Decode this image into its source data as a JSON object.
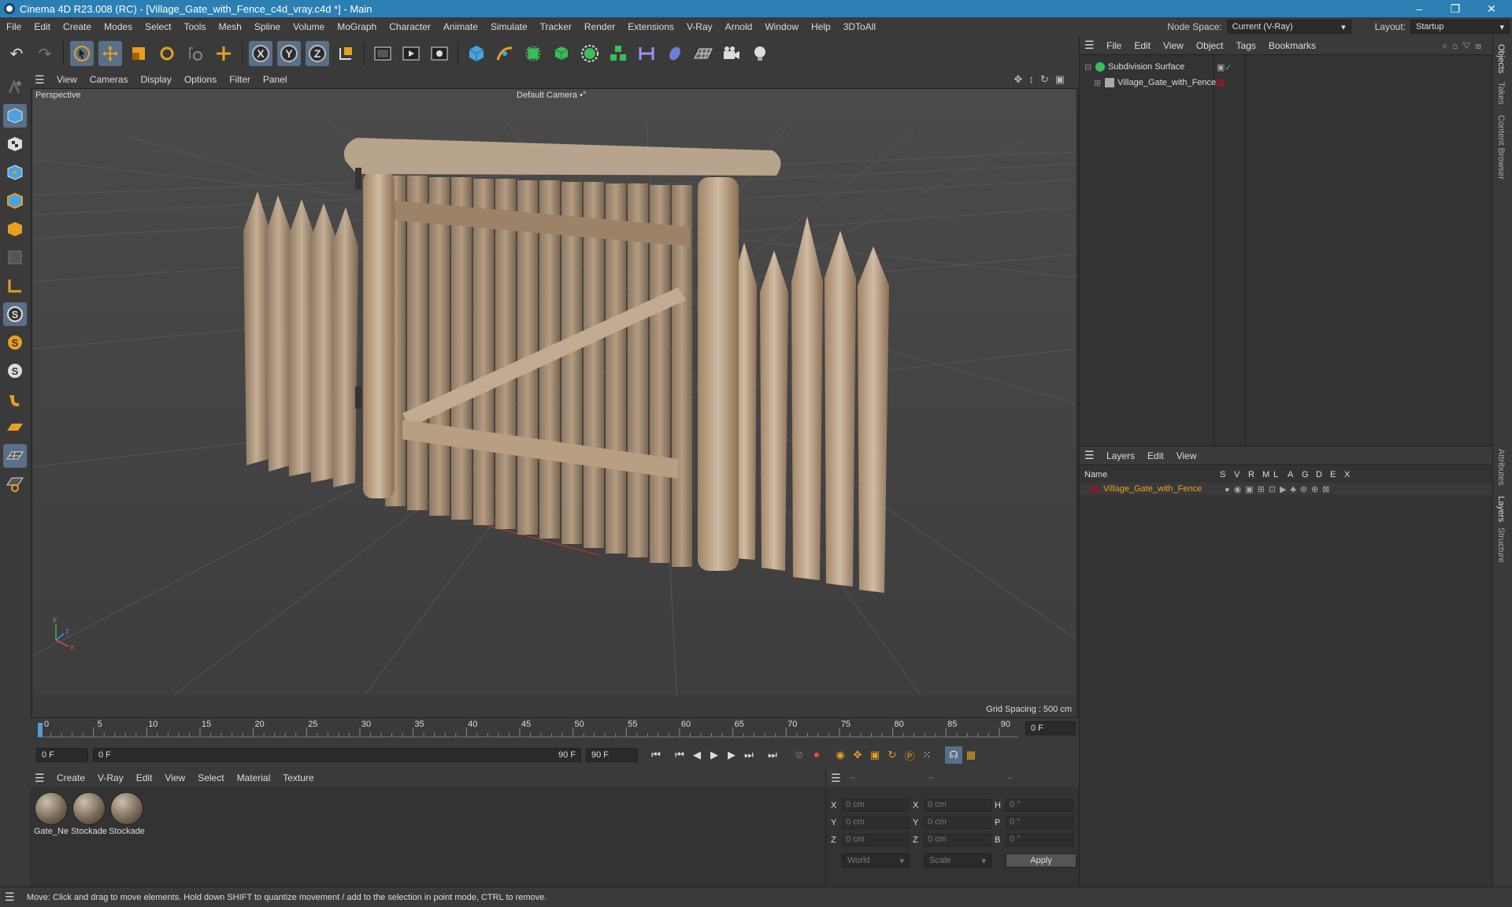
{
  "window": {
    "title": "Cinema 4D R23.008 (RC) - [Village_Gate_with_Fence_c4d_vray.c4d *] - Main",
    "minimize": "–",
    "restore": "❐",
    "close": "✕"
  },
  "menubar": {
    "items": [
      "File",
      "Edit",
      "Create",
      "Modes",
      "Select",
      "Tools",
      "Mesh",
      "Spline",
      "Volume",
      "MoGraph",
      "Character",
      "Animate",
      "Simulate",
      "Tracker",
      "Render",
      "Extensions",
      "V-Ray",
      "Arnold",
      "Window",
      "Help",
      "3DToAll"
    ],
    "node_space_label": "Node Space:",
    "node_space_value": "Current (V-Ray)",
    "layout_label": "Layout:",
    "layout_value": "Startup"
  },
  "toolbar": {
    "icons": [
      "undo-icon",
      "redo-icon",
      "select-arrow-icon",
      "move-icon",
      "scale-icon",
      "rotate-icon",
      "recent-tool-icon",
      "axis-move-icon",
      "x-axis-icon",
      "y-axis-icon",
      "z-axis-icon",
      "coordinate-system-icon",
      "render-region-icon",
      "render-view-icon",
      "render-settings-icon",
      "cube-icon",
      "pen-icon",
      "subdivision-icon",
      "extrude-icon",
      "array-icon",
      "cloner-icon",
      "deformer-icon",
      "field-icon",
      "floor-icon",
      "camera-icon",
      "light-icon"
    ],
    "x_label": "X",
    "y_label": "Y",
    "z_label": "Z"
  },
  "viewport": {
    "menu": [
      "View",
      "Cameras",
      "Display",
      "Options",
      "Filter",
      "Panel"
    ],
    "view_name": "Perspective",
    "camera_name": "Default Camera",
    "camera_suffix": "•°",
    "grid_spacing": "Grid Spacing : 500 cm",
    "axis_x": "x",
    "axis_y": "y",
    "axis_z": "z"
  },
  "timeline": {
    "ticks": [
      "0",
      "5",
      "10",
      "15",
      "20",
      "25",
      "30",
      "35",
      "40",
      "45",
      "50",
      "55",
      "60",
      "65",
      "70",
      "75",
      "80",
      "85",
      "90"
    ],
    "current_frame_right": "0 F"
  },
  "transport": {
    "start_frame": "0 F",
    "range_start": "0 F",
    "range_end": "90 F",
    "end_frame": "90 F"
  },
  "materials": {
    "menu": [
      "Create",
      "V-Ray",
      "Edit",
      "View",
      "Select",
      "Material",
      "Texture"
    ],
    "items": [
      "Gate_Ne",
      "Stockade",
      "Stockade"
    ]
  },
  "coordinates": {
    "head": [
      "--",
      "--",
      "--"
    ],
    "rows": [
      {
        "a": "X",
        "av": "0 cm",
        "b": "X",
        "bv": "0 cm",
        "c": "H",
        "cv": "0 °"
      },
      {
        "a": "Y",
        "av": "0 cm",
        "b": "Y",
        "bv": "0 cm",
        "c": "P",
        "cv": "0 °"
      },
      {
        "a": "Z",
        "av": "0 cm",
        "b": "Z",
        "bv": "0 cm",
        "c": "B",
        "cv": "0 °"
      }
    ],
    "mode": "World",
    "transform": "Scale",
    "apply": "Apply"
  },
  "objects": {
    "menu": [
      "File",
      "Edit",
      "View",
      "Object",
      "Tags",
      "Bookmarks"
    ],
    "items": [
      {
        "name": "Subdivision Surface"
      },
      {
        "name": "Village_Gate_with_Fence"
      }
    ]
  },
  "layers": {
    "menu": [
      "Layers",
      "Edit",
      "View"
    ],
    "columns": [
      "Name",
      "S",
      "V",
      "R",
      "M",
      "L",
      "A",
      "G",
      "D",
      "E",
      "X"
    ],
    "items": [
      {
        "name": "Village_Gate_with_Fence"
      }
    ]
  },
  "side_tabs": [
    "Objects",
    "Takes",
    "Content Browser",
    "Attributes",
    "Layers",
    "Structure"
  ],
  "status": "Move: Click and drag to move elements. Hold down SHIFT to quantize movement / add to the selection in point mode, CTRL to remove.",
  "colors": {
    "accent": "#5a6f88",
    "title_bar": "#2b7fb3",
    "layer_color": "#7a1f2e",
    "orange": "#e8a020"
  }
}
